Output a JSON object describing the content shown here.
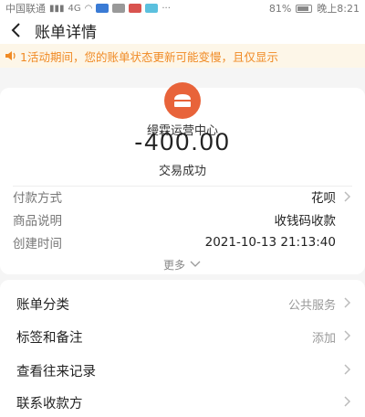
{
  "status_bar": {
    "carrier": "中国联通",
    "signal": "4G",
    "battery": "81%",
    "battery_level": 0.81,
    "time": "晚上8:21"
  },
  "header": {
    "title": "账单详情"
  },
  "notice": {
    "text": "1活动期间，您的账单状态更新可能变慢，且仅显示"
  },
  "transaction": {
    "merchant": "缦霖运营中心",
    "amount": "-400.00",
    "status": "交易成功"
  },
  "details": [
    {
      "label": "付款方式",
      "value": "花呗",
      "has_arrow": true
    },
    {
      "label": "商品说明",
      "value": "收钱码收款",
      "has_arrow": false
    },
    {
      "label": "创建时间",
      "value": "2021-10-13 21:13:40",
      "has_arrow": false
    }
  ],
  "more_label": "更多",
  "menu": [
    {
      "label": "账单分类",
      "value": "公共服务"
    },
    {
      "label": "标签和备注",
      "value": "添加"
    },
    {
      "label": "查看往来记录",
      "value": ""
    },
    {
      "label": "联系收款方",
      "value": ""
    }
  ],
  "colors": {
    "accent_orange": "#f08a24",
    "notice_bg": "#fdf6e8",
    "logo_bg": "#e8633a"
  }
}
